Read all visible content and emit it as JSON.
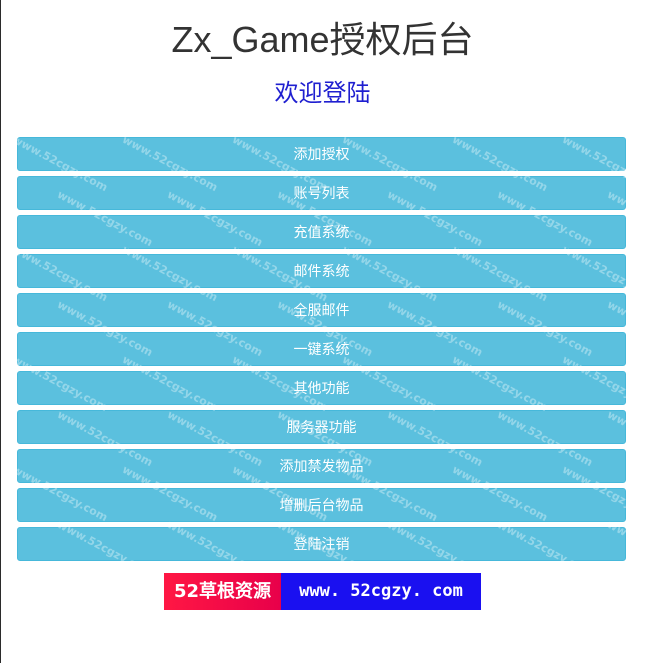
{
  "header": {
    "title": "Zx_Game授权后台",
    "welcome": "欢迎登陆"
  },
  "menu": {
    "items": [
      {
        "label": "添加授权"
      },
      {
        "label": "账号列表"
      },
      {
        "label": "充值系统"
      },
      {
        "label": "邮件系统"
      },
      {
        "label": "全服邮件"
      },
      {
        "label": "一键系统"
      },
      {
        "label": "其他功能"
      },
      {
        "label": "服务器功能"
      },
      {
        "label": "添加禁发物品"
      },
      {
        "label": "增删后台物品"
      },
      {
        "label": "登陆注销"
      }
    ]
  },
  "watermark": {
    "text": "www.52cgzy.com"
  },
  "banner": {
    "left_text": "52草根资源",
    "right_text": "www. 52cgzy. com"
  },
  "colors": {
    "button_bg": "#5bc0de",
    "welcome_text": "#1f1fd0",
    "banner_left": "#ff1744",
    "banner_right": "#1a10f0"
  }
}
